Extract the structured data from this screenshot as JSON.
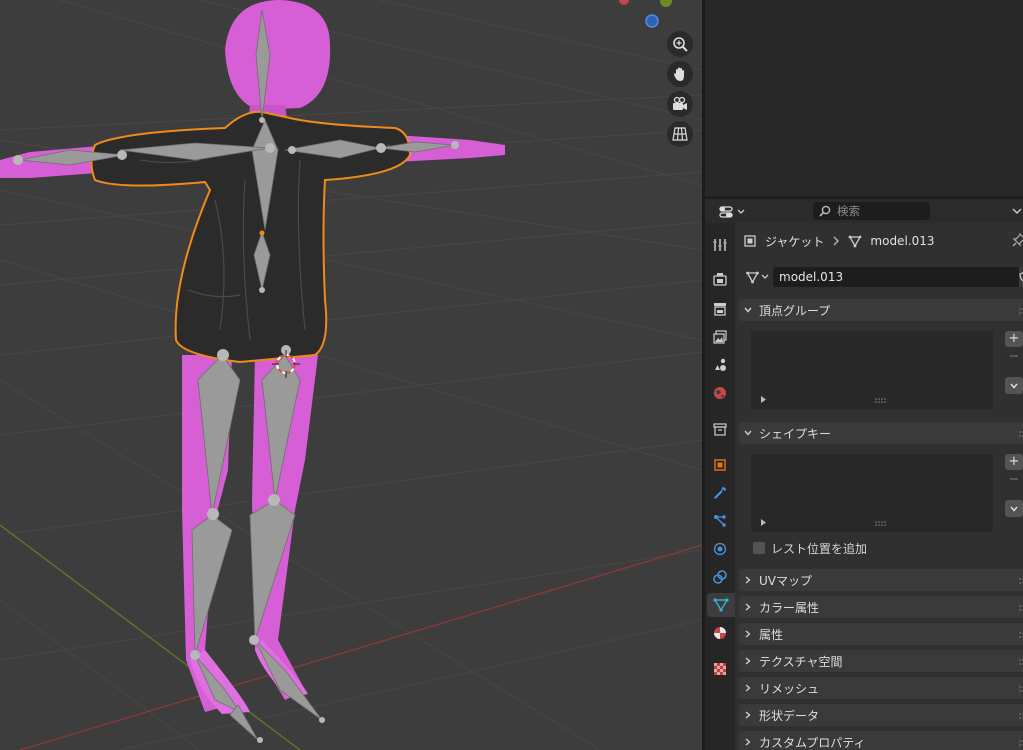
{
  "viewport": {
    "nav_icons": [
      "zoom-icon",
      "hand-pan-icon",
      "camera-icon",
      "grid-perspective-icon"
    ],
    "colors": {
      "background": "#3d3d3d",
      "skin": "#d65fd6",
      "jacket": "#2a2a2a",
      "selection": "#f08a1c",
      "bone": "#9a9a9a"
    }
  },
  "properties": {
    "search_placeholder": "検索",
    "breadcrumb": {
      "object": "ジャケット",
      "mesh": "model.013"
    },
    "datablock_name": "model.013",
    "panels": {
      "vertex_groups": "頂点グループ",
      "shape_keys": "シェイプキー",
      "relative_label": "レスト位置を追加",
      "add_symbol": "+",
      "remove_symbol": "−"
    },
    "collapsed_panels": [
      "UVマップ",
      "カラー属性",
      "属性",
      "テクスチャ空間",
      "リメッシュ",
      "形状データ",
      "カスタムプロパティ"
    ],
    "tabs": [
      "tool-icon",
      "render-icon",
      "output-icon",
      "view-layer-icon",
      "scene-icon",
      "world-icon",
      "collection-icon",
      "object-icon",
      "modifier-icon",
      "particles-icon",
      "physics-icon",
      "constraints-icon",
      "mesh-data-icon",
      "material-icon",
      "texture-icon"
    ],
    "active_tab": "mesh-data-icon"
  }
}
